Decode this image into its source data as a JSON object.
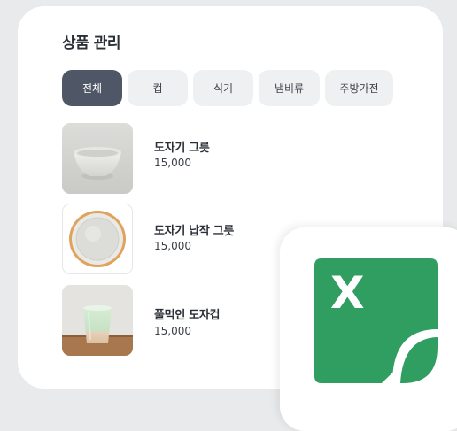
{
  "page": {
    "title": "상품 관리"
  },
  "tabs": [
    {
      "label": "전체",
      "active": true
    },
    {
      "label": "컵",
      "active": false
    },
    {
      "label": "식기",
      "active": false
    },
    {
      "label": "냄비류",
      "active": false
    },
    {
      "label": "주방가전",
      "active": false
    }
  ],
  "products": [
    {
      "name": "도자기 그릇",
      "price": "15,000"
    },
    {
      "name": "도자기 납작 그릇",
      "price": "15,000"
    },
    {
      "name": "풀먹인 도자컵",
      "price": "15,000"
    }
  ],
  "excel_badge": {
    "icon": "excel-icon",
    "letter": "X",
    "color": "#2f9e60"
  }
}
